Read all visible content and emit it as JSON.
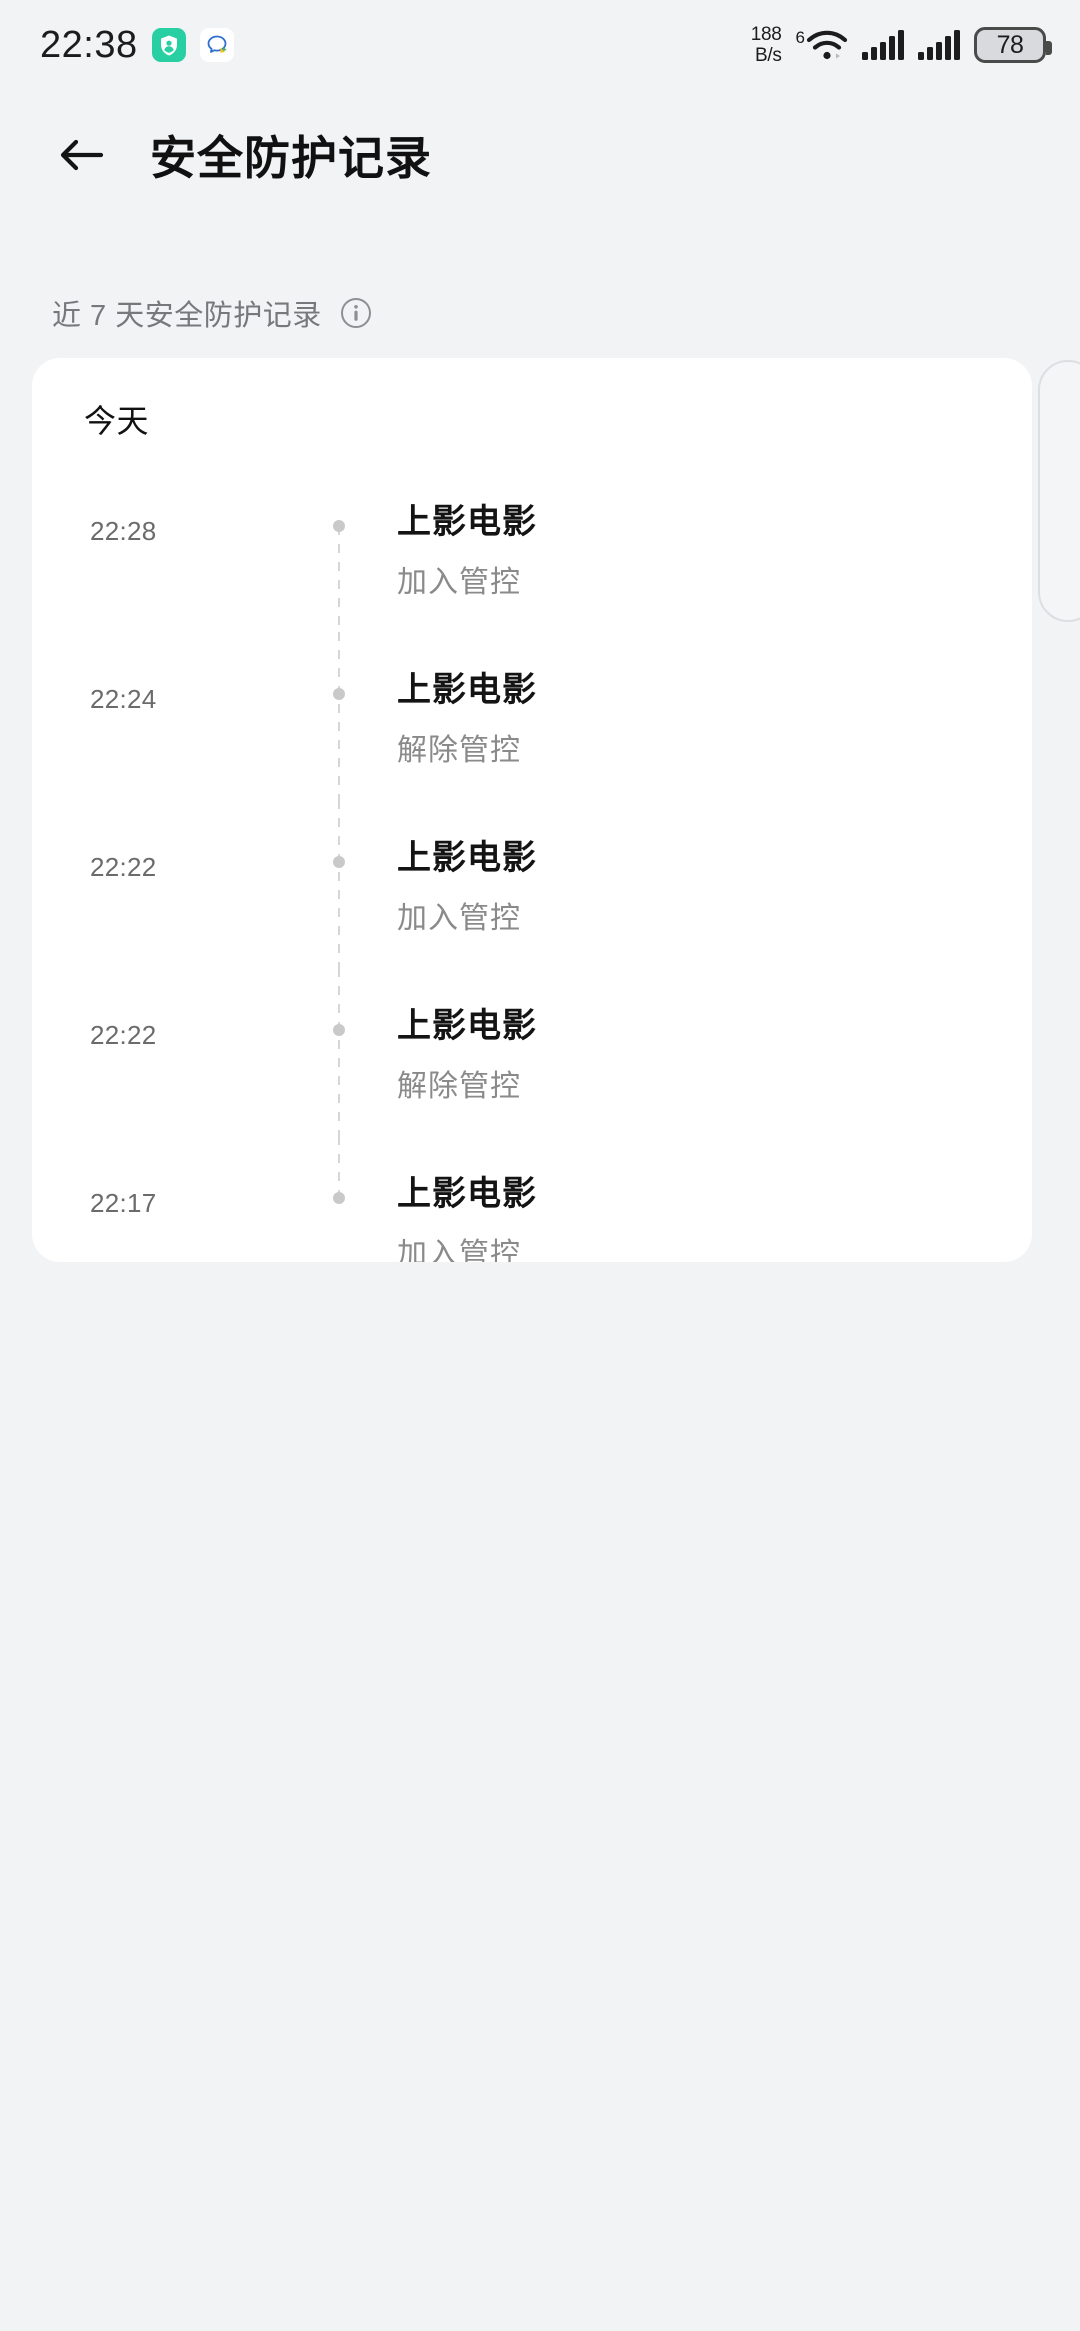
{
  "status_bar": {
    "clock": "22:38",
    "notification_icons": [
      {
        "name": "security-shield-app-icon",
        "style": "teal"
      },
      {
        "name": "chat-bubble-app-icon",
        "style": "white"
      }
    ],
    "network_speed_value": "188",
    "network_speed_unit": "B/s",
    "wifi_generation": "6",
    "wifi_icon": "wifi-icon",
    "signal_icons": [
      "signal-bars-sim1-icon",
      "signal-bars-sim2-icon"
    ],
    "battery_percent": "78"
  },
  "app_bar": {
    "back_icon": "back-arrow-icon",
    "title": "安全防护记录"
  },
  "section": {
    "label": "近 7 天安全防护记录",
    "info_icon": "info-icon"
  },
  "card": {
    "group_title": "今天",
    "entries": [
      {
        "time": "22:28",
        "app": "上影电影",
        "action": "加入管控"
      },
      {
        "time": "22:24",
        "app": "上影电影",
        "action": "解除管控"
      },
      {
        "time": "22:22",
        "app": "上影电影",
        "action": "加入管控"
      },
      {
        "time": "22:22",
        "app": "上影电影",
        "action": "解除管控"
      },
      {
        "time": "22:17",
        "app": "上影电影",
        "action": "加入管控"
      }
    ]
  },
  "colors": {
    "page_background": "#f2f3f5",
    "card_background": "#ffffff",
    "title_text": "#111111",
    "secondary_text": "#8a8a8a",
    "time_text": "#6b6b6b",
    "timeline_dot": "#c9c9c9",
    "accent_teal": "#27cfa2"
  }
}
